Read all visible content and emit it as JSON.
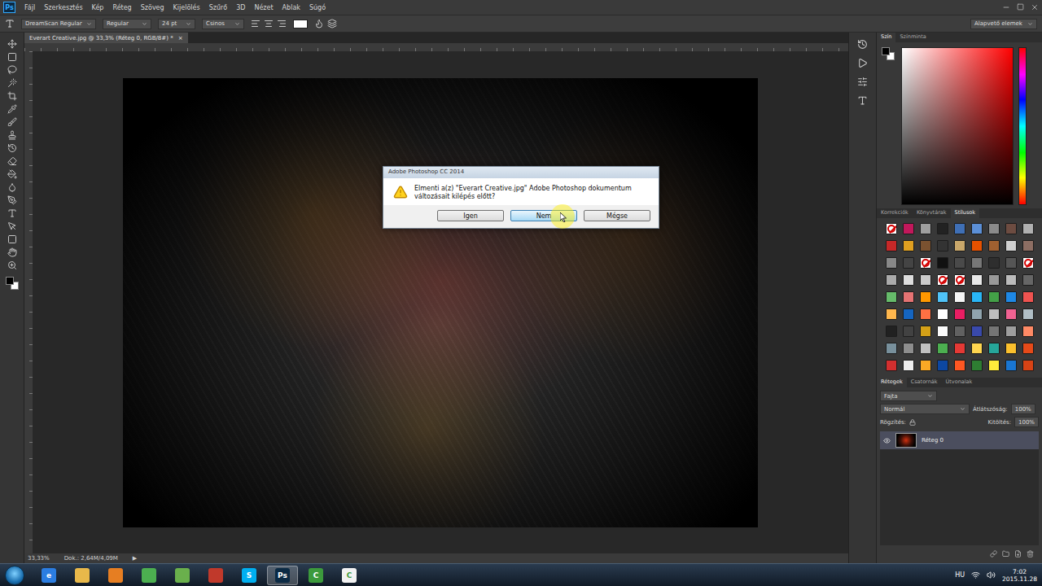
{
  "app": {
    "logo": "Ps"
  },
  "menu": [
    "Fájl",
    "Szerkesztés",
    "Kép",
    "Réteg",
    "Szöveg",
    "Kijelölés",
    "Szűrő",
    "3D",
    "Nézet",
    "Ablak",
    "Súgó"
  ],
  "options_bar": {
    "font_family": "DreamScan Regular",
    "font_style": "Regular",
    "font_size": "24 pt",
    "anti_alias": "Csinos",
    "workspace": "Alapvető elemek"
  },
  "document_tab": {
    "title": "Everart Creative.jpg @ 33,3% (Réteg 0, RGB/8#) *",
    "close": "×"
  },
  "dialog": {
    "title": "Adobe Photoshop CC 2014",
    "message": "Elmenti a(z) \"Everart Creative.jpg\" Adobe Photoshop dokumentum változásait kilépés előtt?",
    "buttons": [
      {
        "label": "Igen",
        "hovered": false
      },
      {
        "label": "Nem",
        "hovered": true
      },
      {
        "label": "Mégse",
        "hovered": false
      }
    ]
  },
  "status_bar": {
    "zoom": "33,33%",
    "doc_size": "Dok.: 2,64M/4,09M",
    "arrow": "▶"
  },
  "color_panel": {
    "tabs": [
      {
        "label": "Szín",
        "selected": true
      },
      {
        "label": "Színminta",
        "selected": false
      }
    ],
    "foreground": "#000000",
    "background": "#ffffff"
  },
  "styles_panel": {
    "tabs": [
      {
        "label": "Korrekciók",
        "selected": false
      },
      {
        "label": "Könyvtárak",
        "selected": false
      },
      {
        "label": "Stílusok",
        "selected": true
      }
    ],
    "swatches": [
      {
        "kind": "none",
        "color": "#ffffff"
      },
      {
        "kind": "fill",
        "color": "#c2185b"
      },
      {
        "kind": "fill",
        "color": "#9e9e9e"
      },
      {
        "kind": "fill",
        "color": "#222222"
      },
      {
        "kind": "fill",
        "color": "#3f6fb5"
      },
      {
        "kind": "fill",
        "color": "#5b8fd6"
      },
      {
        "kind": "fill",
        "color": "#8a8a8a"
      },
      {
        "kind": "fill",
        "color": "#6d4c41"
      },
      {
        "kind": "fill",
        "color": "#b0b0b0"
      },
      {
        "kind": "fill",
        "color": "#c62828"
      },
      {
        "kind": "fill",
        "color": "#e0a020"
      },
      {
        "kind": "fill",
        "color": "#7a5230"
      },
      {
        "kind": "fill",
        "color": "#333333"
      },
      {
        "kind": "fill",
        "color": "#c9a76a"
      },
      {
        "kind": "fill",
        "color": "#e65100"
      },
      {
        "kind": "fill",
        "color": "#a06030"
      },
      {
        "kind": "fill",
        "color": "#cfcfcf"
      },
      {
        "kind": "fill",
        "color": "#8d6e63"
      },
      {
        "kind": "fill",
        "color": "#888888"
      },
      {
        "kind": "fill",
        "color": "#444444"
      },
      {
        "kind": "none",
        "color": "#ffffff"
      },
      {
        "kind": "fill",
        "color": "#111111"
      },
      {
        "kind": "fill",
        "color": "#4a4a4a"
      },
      {
        "kind": "fill",
        "color": "#777777"
      },
      {
        "kind": "fill",
        "color": "#2e2e2e"
      },
      {
        "kind": "fill",
        "color": "#555555"
      },
      {
        "kind": "none",
        "color": "#ffffff"
      },
      {
        "kind": "fill",
        "color": "#aaaaaa"
      },
      {
        "kind": "fill",
        "color": "#dddddd"
      },
      {
        "kind": "fill",
        "color": "#cccccc"
      },
      {
        "kind": "none",
        "color": "#ffffff"
      },
      {
        "kind": "none",
        "color": "#ffffff"
      },
      {
        "kind": "fill",
        "color": "#e8e8e8"
      },
      {
        "kind": "fill",
        "color": "#999999"
      },
      {
        "kind": "fill",
        "color": "#bbbbbb"
      },
      {
        "kind": "fill",
        "color": "#666666"
      },
      {
        "kind": "fill",
        "color": "#66bb6a"
      },
      {
        "kind": "fill",
        "color": "#e57373"
      },
      {
        "kind": "fill",
        "color": "#ff9800"
      },
      {
        "kind": "fill",
        "color": "#4fc3f7"
      },
      {
        "kind": "fill",
        "color": "#f5f5f5"
      },
      {
        "kind": "fill",
        "color": "#29b6f6"
      },
      {
        "kind": "fill",
        "color": "#43a047"
      },
      {
        "kind": "fill",
        "color": "#1e88e5"
      },
      {
        "kind": "fill",
        "color": "#ef5350"
      },
      {
        "kind": "fill",
        "color": "#ffb74d"
      },
      {
        "kind": "fill",
        "color": "#1565c0"
      },
      {
        "kind": "fill",
        "color": "#ff7043"
      },
      {
        "kind": "fill",
        "color": "#ffffff"
      },
      {
        "kind": "fill",
        "color": "#e91e63"
      },
      {
        "kind": "fill",
        "color": "#90a4ae"
      },
      {
        "kind": "fill",
        "color": "#bdbdbd"
      },
      {
        "kind": "fill",
        "color": "#f06292"
      },
      {
        "kind": "fill",
        "color": "#b0bec5"
      },
      {
        "kind": "fill",
        "color": "#212121"
      },
      {
        "kind": "fill",
        "color": "#424242"
      },
      {
        "kind": "fill",
        "color": "#d4a017"
      },
      {
        "kind": "fill",
        "color": "#fafafa"
      },
      {
        "kind": "fill",
        "color": "#616161"
      },
      {
        "kind": "fill",
        "color": "#3949ab"
      },
      {
        "kind": "fill",
        "color": "#757575"
      },
      {
        "kind": "fill",
        "color": "#9e9e9e"
      },
      {
        "kind": "fill",
        "color": "#ff8a65"
      },
      {
        "kind": "fill",
        "color": "#78909c"
      },
      {
        "kind": "fill",
        "color": "#8d8d8d"
      },
      {
        "kind": "fill",
        "color": "#c0c0c0"
      },
      {
        "kind": "fill",
        "color": "#4caf50"
      },
      {
        "kind": "fill",
        "color": "#e53935"
      },
      {
        "kind": "fill",
        "color": "#ffd54f"
      },
      {
        "kind": "fill",
        "color": "#26a69a"
      },
      {
        "kind": "fill",
        "color": "#fbc02d"
      },
      {
        "kind": "fill",
        "color": "#e64a19"
      },
      {
        "kind": "fill",
        "color": "#d32f2f"
      },
      {
        "kind": "fill",
        "color": "#eeeeee"
      },
      {
        "kind": "fill",
        "color": "#f9a825"
      },
      {
        "kind": "fill",
        "color": "#0d47a1"
      },
      {
        "kind": "fill",
        "color": "#ff5722"
      },
      {
        "kind": "fill",
        "color": "#2e7d32"
      },
      {
        "kind": "fill",
        "color": "#ffeb3b"
      },
      {
        "kind": "fill",
        "color": "#1976d2"
      },
      {
        "kind": "fill",
        "color": "#d84315"
      }
    ]
  },
  "layers_panel": {
    "tabs": [
      {
        "label": "Rétegek",
        "selected": true
      },
      {
        "label": "Csatornák",
        "selected": false
      },
      {
        "label": "Útvonalak",
        "selected": false
      }
    ],
    "filter": "Fajta",
    "blend_mode": "Normál",
    "opacity_label": "Átlátszóság:",
    "opacity": "100%",
    "lock_label": "Rögzítés:",
    "fill_label": "Kitöltés:",
    "fill": "100%",
    "layers": [
      {
        "name": "Réteg 0",
        "visible": true,
        "selected": true
      }
    ]
  },
  "taskbar": {
    "apps": [
      {
        "glyph": "e",
        "color": "#2b7de1",
        "active": false
      },
      {
        "glyph": "",
        "color": "#e8b84a",
        "active": false
      },
      {
        "glyph": "",
        "color": "#e67e22",
        "active": false
      },
      {
        "glyph": "",
        "color": "#4caf50",
        "active": false
      },
      {
        "glyph": "",
        "color": "#6ab04c",
        "active": false
      },
      {
        "glyph": "",
        "color": "#c0392b",
        "active": false
      },
      {
        "glyph": "S",
        "color": "#00aff0",
        "active": false
      },
      {
        "glyph": "Ps",
        "color": "#0b2a44",
        "active": true
      },
      {
        "glyph": "C",
        "color": "#3c9a3c",
        "active": false
      },
      {
        "glyph": "C",
        "color": "#f2f2f2",
        "active": false
      }
    ],
    "language": "HU",
    "time": "7:02",
    "date": "2015.11.28"
  }
}
